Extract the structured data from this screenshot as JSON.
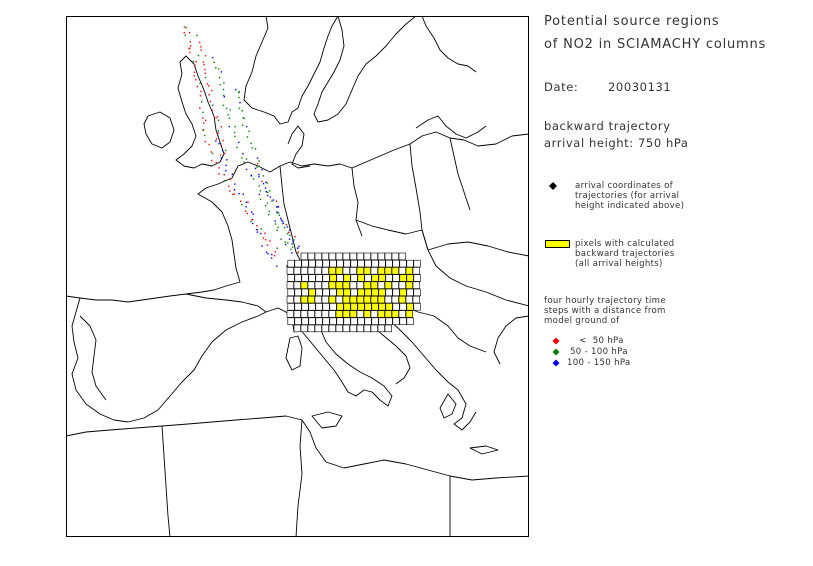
{
  "title": {
    "line1": "Potential source regions",
    "line2": "of NO2 in SCIAMACHY columns"
  },
  "date": {
    "label": "Date:",
    "value": "20030131"
  },
  "trajectory": {
    "line1": "backward trajectory",
    "line2": "arrival height: 750 hPa"
  },
  "legend": {
    "arrival": {
      "symbol_color": "#000000",
      "lines": [
        "arrival coordinates of",
        "trajectories (for arrival",
        "height indicated above)"
      ]
    },
    "pixels": {
      "fill_color": "#ffff00",
      "lines": [
        "pixels with calculated",
        "backward trajectories",
        "(all arrival heights)"
      ]
    },
    "timesteps": {
      "lines": [
        "four hourly trajectory time",
        "steps with a distance from",
        "model ground of"
      ]
    },
    "ranges": [
      {
        "color": "#ff0000",
        "label": "    <  50 hPa"
      },
      {
        "color": "#008000",
        "label": " 50 - 100 hPa"
      },
      {
        "color": "#0000ff",
        "label": "100 - 150 hPa"
      }
    ]
  },
  "map": {
    "region": "Europe",
    "coastline_color": "#000000",
    "grid_fill": "#ffff00"
  }
}
